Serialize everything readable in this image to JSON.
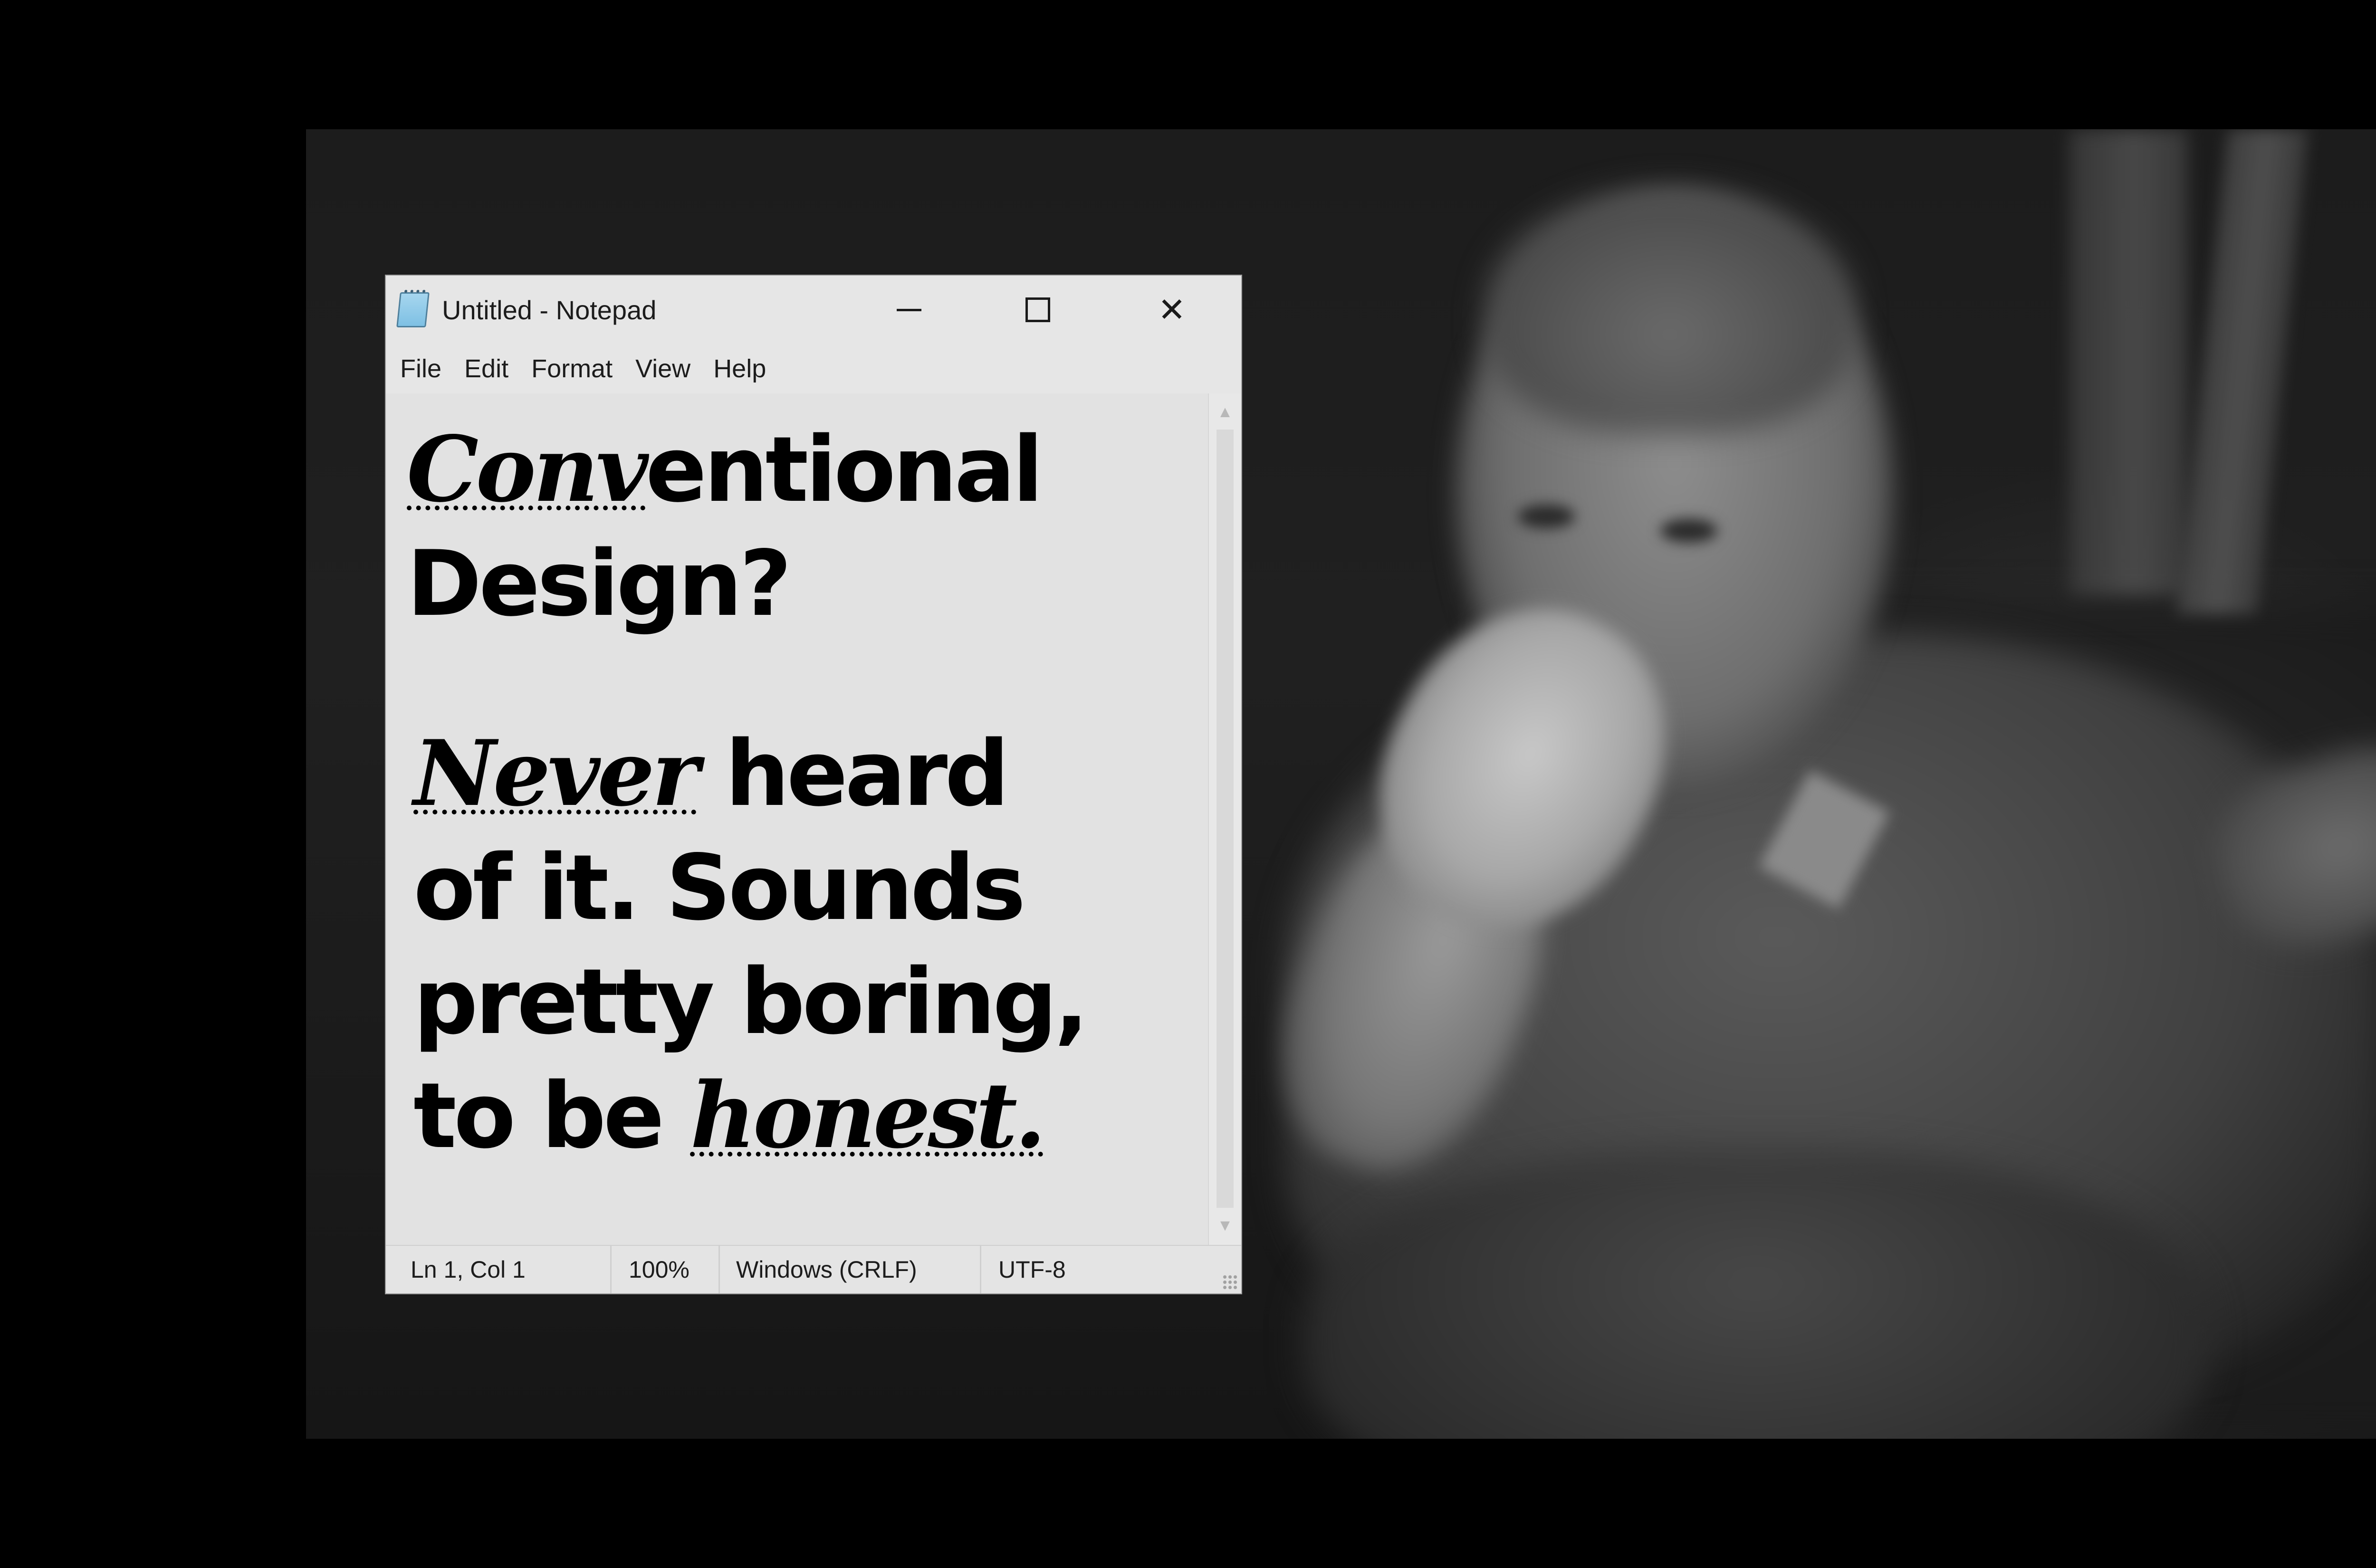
{
  "window": {
    "title": "Untitled - Notepad",
    "controls": {
      "minimize_icon": "minimize-icon",
      "maximize_icon": "maximize-icon",
      "close_glyph": "✕"
    }
  },
  "menu": {
    "items": [
      {
        "label": "File"
      },
      {
        "label": "Edit"
      },
      {
        "label": "Format"
      },
      {
        "label": "View"
      },
      {
        "label": "Help"
      }
    ]
  },
  "editor": {
    "lines": [
      {
        "fancy": "Conv",
        "plain": "entional"
      },
      {
        "fancy": "",
        "plain": "Design?"
      },
      {
        "fancy": "Never",
        "plain": " heard"
      },
      {
        "fancy": "",
        "plain": "of it. Sounds"
      },
      {
        "fancy": "",
        "plain": "pretty boring,"
      },
      {
        "fancy": "honest.",
        "plain": "to be "
      }
    ]
  },
  "status": {
    "position": "Ln 1, Col 1",
    "zoom": "100%",
    "line_endings": "Windows (CRLF)",
    "encoding": "UTF-8"
  },
  "colors": {
    "desktop": "#000000",
    "window_chrome": "#e6e6e6",
    "editor_bg": "#e2e2e2",
    "text": "#000000"
  }
}
